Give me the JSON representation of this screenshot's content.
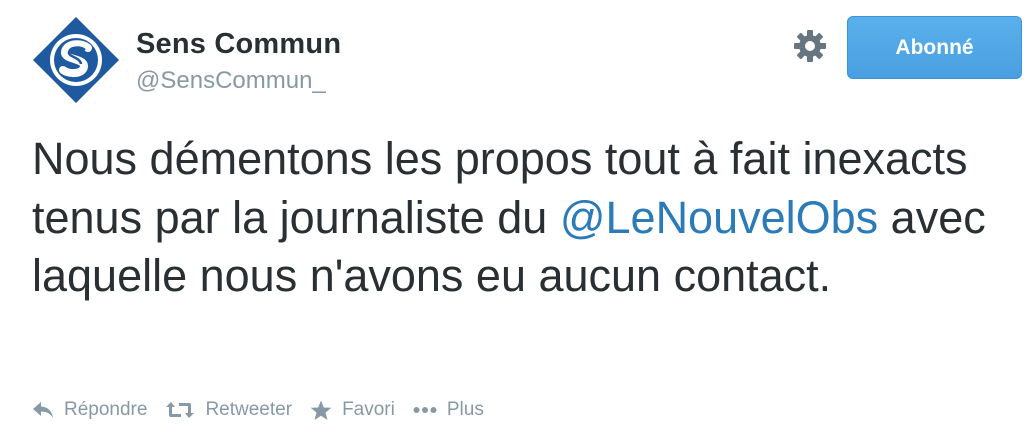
{
  "header": {
    "display_name": "Sens Commun",
    "handle": "@SensCommun_",
    "follow_button_label": "Abonné",
    "avatar_icon": "sens-commun-logo-icon",
    "settings_icon": "gear-icon"
  },
  "tweet": {
    "text_before": "Nous démentons les propos tout à fait inexacts tenus par la journaliste du ",
    "mention": "@LeNouvelObs",
    "text_after": " avec laquelle nous n'avons eu aucun contact."
  },
  "actions": [
    {
      "label": "Répondre",
      "icon": "reply-icon"
    },
    {
      "label": "Retweeter",
      "icon": "retweet-icon"
    },
    {
      "label": "Favori",
      "icon": "star-icon"
    },
    {
      "label": "Plus",
      "icon": "more-icon"
    }
  ],
  "colors": {
    "accent": "#2b7bb9",
    "button": "#4a9fe0",
    "muted": "#8899a6",
    "logo": "#1f5aa0"
  }
}
